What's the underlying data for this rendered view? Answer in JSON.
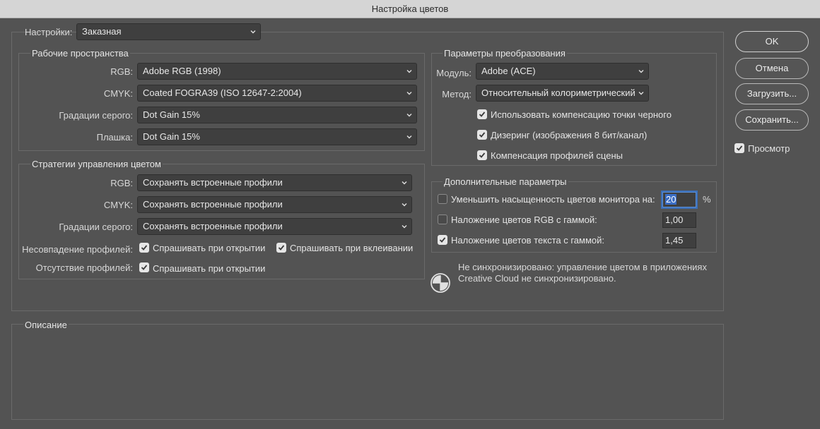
{
  "window": {
    "title": "Настройка цветов"
  },
  "settings": {
    "label": "Настройки:",
    "value": "Заказная"
  },
  "working_spaces": {
    "title": "Рабочие пространства",
    "rows": [
      {
        "label": "RGB:",
        "value": "Adobe RGB (1998)"
      },
      {
        "label": "CMYK:",
        "value": "Coated FOGRA39 (ISO 12647-2:2004)"
      },
      {
        "label": "Градации серого:",
        "value": "Dot Gain 15%"
      },
      {
        "label": "Плашка:",
        "value": "Dot Gain 15%"
      }
    ]
  },
  "policies": {
    "title": "Стратегии управления цветом",
    "rows": [
      {
        "label": "RGB:",
        "value": "Сохранять встроенные профили"
      },
      {
        "label": "CMYK:",
        "value": "Сохранять встроенные профили"
      },
      {
        "label": "Градации серого:",
        "value": "Сохранять встроенные профили"
      }
    ],
    "mismatch_label": "Несовпадение профилей:",
    "mismatch_open": {
      "label": "Спрашивать при открытии",
      "checked": true
    },
    "mismatch_paste": {
      "label": "Спрашивать при вклеивании",
      "checked": true
    },
    "missing_label": "Отсутствие профилей:",
    "missing_open": {
      "label": "Спрашивать при открытии",
      "checked": true
    }
  },
  "conversion": {
    "title": "Параметры преобразования",
    "engine_label": "Модуль:",
    "engine_value": "Adobe (ACE)",
    "intent_label": "Метод:",
    "intent_value": "Относительный колориметрический",
    "bpc": {
      "label": "Использовать компенсацию точки черного",
      "checked": true
    },
    "dither": {
      "label": "Дизеринг (изображения 8 бит/канал)",
      "checked": true
    },
    "scene": {
      "label": "Компенсация профилей сцены",
      "checked": true
    }
  },
  "advanced": {
    "title": "Дополнительные параметры",
    "desaturate": {
      "label": "Уменьшить насыщенность цветов монитора на:",
      "checked": false,
      "value": "20",
      "unit": "%"
    },
    "blend_rgb": {
      "label": "Наложение цветов RGB с гаммой:",
      "checked": false,
      "value": "1,00"
    },
    "blend_text": {
      "label": "Наложение цветов текста с гаммой:",
      "checked": true,
      "value": "1,45"
    }
  },
  "sync": {
    "line1": "Не синхронизировано: управление цветом в приложениях",
    "line2": "Creative Cloud не синхронизировано."
  },
  "description": {
    "title": "Описание"
  },
  "buttons": {
    "ok": "OK",
    "cancel": "Отмена",
    "load": "Загрузить...",
    "save": "Сохранить..."
  },
  "preview": {
    "label": "Просмотр",
    "checked": true
  }
}
